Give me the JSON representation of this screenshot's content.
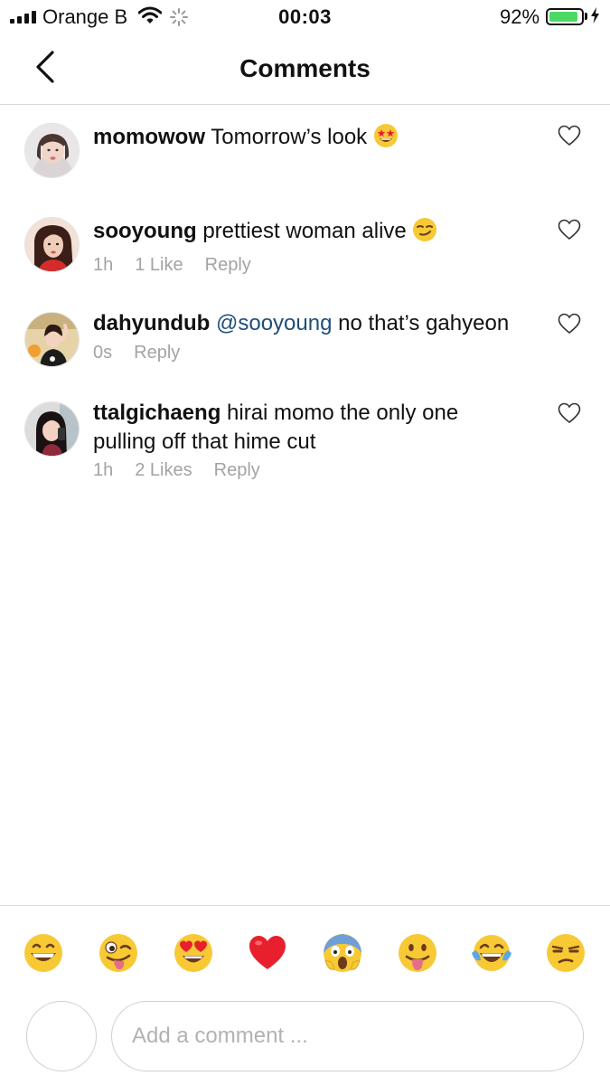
{
  "status_bar": {
    "carrier": "Orange B",
    "time": "00:03",
    "battery_percent": "92%",
    "battery_level": 0.92
  },
  "header": {
    "title": "Comments"
  },
  "comments": [
    {
      "username": "momowow",
      "text": "Tomorrow’s look",
      "emoji": "star-struck-emoji",
      "meta": []
    },
    {
      "username": "sooyoung",
      "text": "prettiest woman alive",
      "emoji": "smirk-emoji",
      "meta": [
        "1h",
        "1 Like",
        "Reply"
      ]
    },
    {
      "username": "dahyundub",
      "mention": "@sooyoung",
      "text": "no that’s gahyeon",
      "meta": [
        "0s",
        "Reply"
      ]
    },
    {
      "username": "ttalgichaeng",
      "text": "hirai momo the only one",
      "text_line2": "pulling off that hime cut",
      "meta": [
        "1h",
        "2 Likes",
        "Reply"
      ]
    }
  ],
  "emoji_bar": [
    "grinning-emoji",
    "winking-tongue-emoji",
    "heart-eyes-emoji",
    "red-heart-emoji",
    "screaming-emoji",
    "tongue-out-emoji",
    "tears-of-joy-emoji",
    "unamused-emoji"
  ],
  "composer": {
    "placeholder": "Add a comment ..."
  },
  "colors": {
    "mention": "#1f4e79",
    "meta": "#a3a3a3",
    "battery": "#4cd964",
    "emoji_yellow": "#f7c935",
    "heart_red": "#e8202d"
  }
}
